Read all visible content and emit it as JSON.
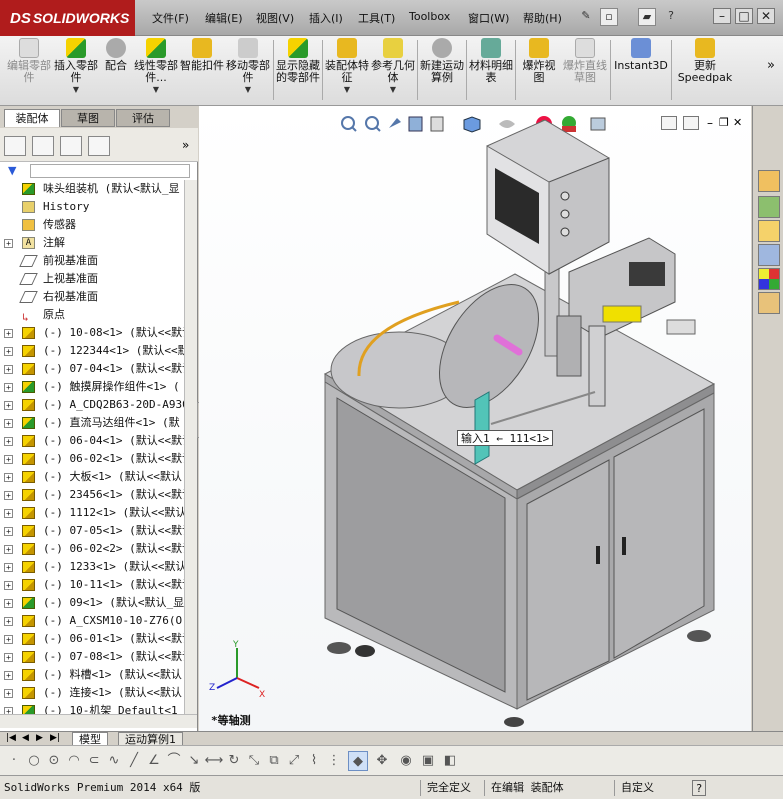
{
  "app": {
    "brand": "SOLIDWORKS",
    "menu": [
      "文件(F)",
      "编辑(E)",
      "视图(V)",
      "插入(I)",
      "工具(T)",
      "Toolbox",
      "窗口(W)",
      "帮助(H)"
    ],
    "help_label": "?"
  },
  "ribbon": {
    "buttons": [
      {
        "label": "编辑零部件",
        "disabled": true
      },
      {
        "label": "插入零部件",
        "disabled": false
      },
      {
        "label": "配合",
        "disabled": false
      },
      {
        "label": "线性零部件...",
        "disabled": false
      },
      {
        "label": "智能扣件",
        "disabled": false
      },
      {
        "label": "移动零部件",
        "disabled": false
      },
      {
        "label": "显示隐藏的零部件",
        "disabled": false
      },
      {
        "label": "装配体特征",
        "disabled": false
      },
      {
        "label": "参考几何体",
        "disabled": false
      },
      {
        "label": "新建运动算例",
        "disabled": false
      },
      {
        "label": "材料明细表",
        "disabled": false
      },
      {
        "label": "爆炸视图",
        "disabled": false
      },
      {
        "label": "爆炸直线草图",
        "disabled": true
      },
      {
        "label": "Instant3D",
        "disabled": false
      },
      {
        "label": "更新Speedpak",
        "disabled": false
      }
    ],
    "more": "»"
  },
  "left_tabs": [
    "装配体",
    "草图",
    "评估"
  ],
  "tree": {
    "root": "味头组装机  (默认<默认_显",
    "items": [
      {
        "expand": "",
        "icon": "history",
        "label": "History"
      },
      {
        "expand": "",
        "icon": "sensor",
        "label": "传感器"
      },
      {
        "expand": "+",
        "icon": "annotation",
        "label": "注解"
      },
      {
        "expand": "",
        "icon": "plane",
        "label": "前视基准面"
      },
      {
        "expand": "",
        "icon": "plane",
        "label": "上视基准面"
      },
      {
        "expand": "",
        "icon": "plane",
        "label": "右视基准面"
      },
      {
        "expand": "",
        "icon": "origin",
        "label": "原点"
      },
      {
        "expand": "+",
        "icon": "part",
        "label": "(-) 10-08<1> (默认<<默认"
      },
      {
        "expand": "+",
        "icon": "part",
        "label": "(-) 122344<1> (默认<<默"
      },
      {
        "expand": "+",
        "icon": "part",
        "label": "(-) 07-04<1> (默认<<默认"
      },
      {
        "expand": "+",
        "icon": "asm",
        "label": "(-) 触摸屏操作组件<1> ("
      },
      {
        "expand": "+",
        "icon": "part",
        "label": "(-) A_CDQ2B63-20D-A930<"
      },
      {
        "expand": "+",
        "icon": "asm",
        "label": "(-) 直流马达组件<1> (默"
      },
      {
        "expand": "+",
        "icon": "part",
        "label": "(-) 06-04<1> (默认<<默认"
      },
      {
        "expand": "+",
        "icon": "part",
        "label": "(-) 06-02<1> (默认<<默认"
      },
      {
        "expand": "+",
        "icon": "part",
        "label": "(-) 大板<1> (默认<<默认"
      },
      {
        "expand": "+",
        "icon": "part",
        "label": "(-) 23456<1> (默认<<默认"
      },
      {
        "expand": "+",
        "icon": "part",
        "label": "(-) 1112<1> (默认<<默认"
      },
      {
        "expand": "+",
        "icon": "part",
        "label": "(-) 07-05<1> (默认<<默认"
      },
      {
        "expand": "+",
        "icon": "part",
        "label": "(-) 06-02<2> (默认<<默认"
      },
      {
        "expand": "+",
        "icon": "part",
        "label": "(-) 1233<1> (默认<<默认"
      },
      {
        "expand": "+",
        "icon": "part",
        "label": "(-) 10-11<1> (默认<<默认"
      },
      {
        "expand": "+",
        "icon": "asm",
        "label": "(-) 09<1> (默认<默认_显"
      },
      {
        "expand": "+",
        "icon": "part",
        "label": "(-) A_CXSM10-10-Z76(O)<"
      },
      {
        "expand": "+",
        "icon": "part",
        "label": "(-) 06-01<1> (默认<<默认"
      },
      {
        "expand": "+",
        "icon": "part",
        "label": "(-) 07-08<1> (默认<<默认"
      },
      {
        "expand": "+",
        "icon": "part",
        "label": "(-) 料槽<1> (默认<<默认"
      },
      {
        "expand": "+",
        "icon": "part",
        "label": "(-) 连接<1> (默认<<默认"
      },
      {
        "expand": "+",
        "icon": "asm",
        "label": "(-) 10-机架 Default<1"
      }
    ]
  },
  "viewport": {
    "view_name": "*等轴测",
    "callout": "输入1 ← 111<1>",
    "axis": {
      "x": "X",
      "y": "Y",
      "z": "Z"
    }
  },
  "bottom_tabs": [
    "模型",
    "运动算例1"
  ],
  "status": {
    "product": "SolidWorks Premium 2014 x64 版",
    "state": "完全定义",
    "editing": "在编辑 装配体",
    "custom": "自定义",
    "help": "?"
  },
  "colors": {
    "brand_red": "#b01c1c",
    "frame_gray": "#c8c8c8",
    "accent_orange": "#e0a020",
    "accent_pink": "#e070d8",
    "accent_yellow": "#f0e000"
  }
}
